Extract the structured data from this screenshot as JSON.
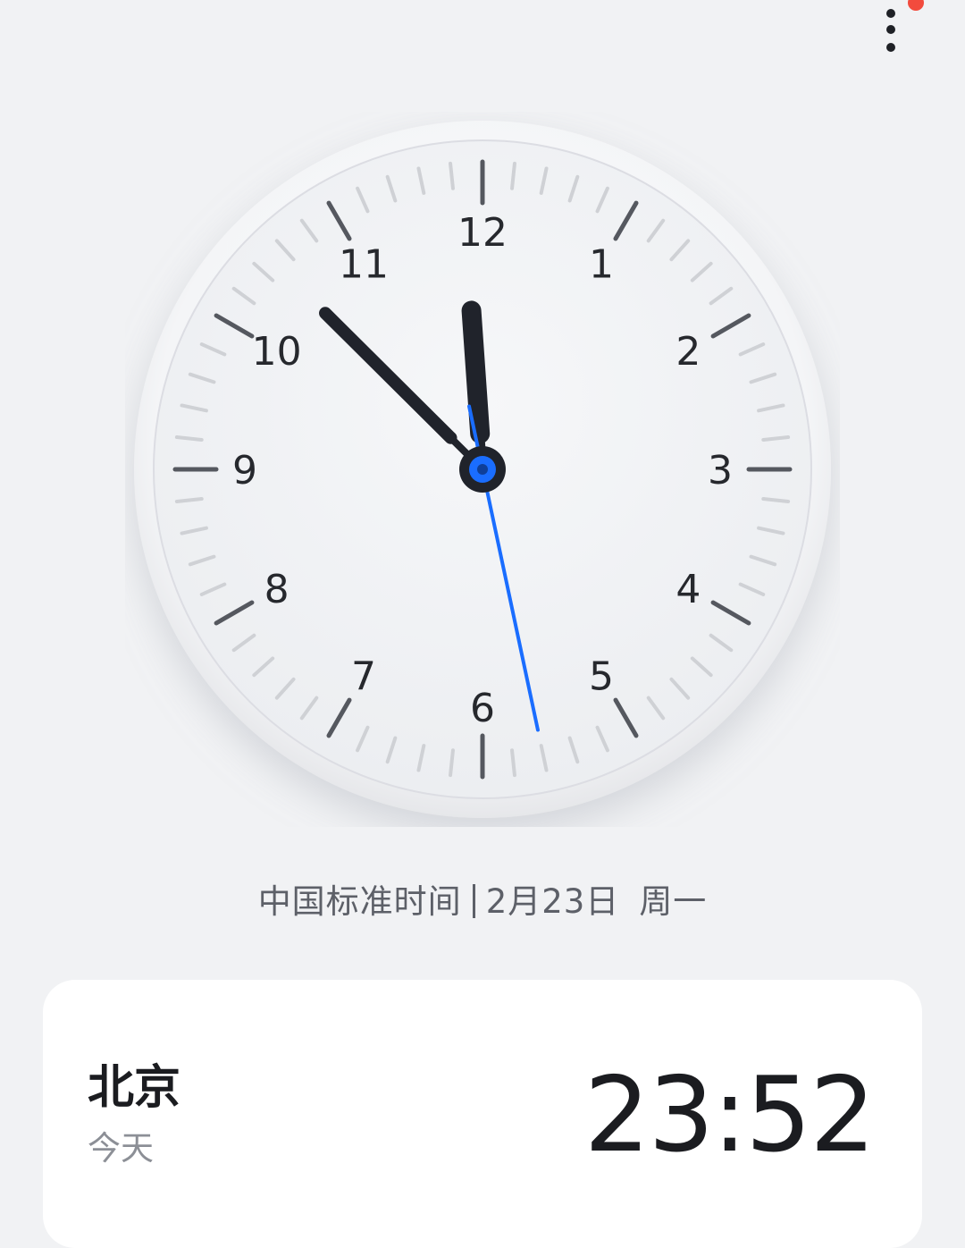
{
  "toolbar": {
    "more_icon": "more-vertical-icon",
    "has_notification": true
  },
  "clock": {
    "numbers": [
      "12",
      "1",
      "2",
      "3",
      "4",
      "5",
      "6",
      "7",
      "8",
      "9",
      "10",
      "11"
    ],
    "time": {
      "hour": 11,
      "minute": 52,
      "second": 28
    },
    "colors": {
      "hands": "#20232b",
      "second_hand": "#1a6dff",
      "ticks_major": "#55585f",
      "ticks_minor": "#cfd1d5"
    }
  },
  "date_line": {
    "timezone": "中国标准时间",
    "date": "2月23日",
    "weekday": "周一"
  },
  "world_clock": {
    "city": "北京",
    "day": "今天",
    "time": "23:52"
  }
}
